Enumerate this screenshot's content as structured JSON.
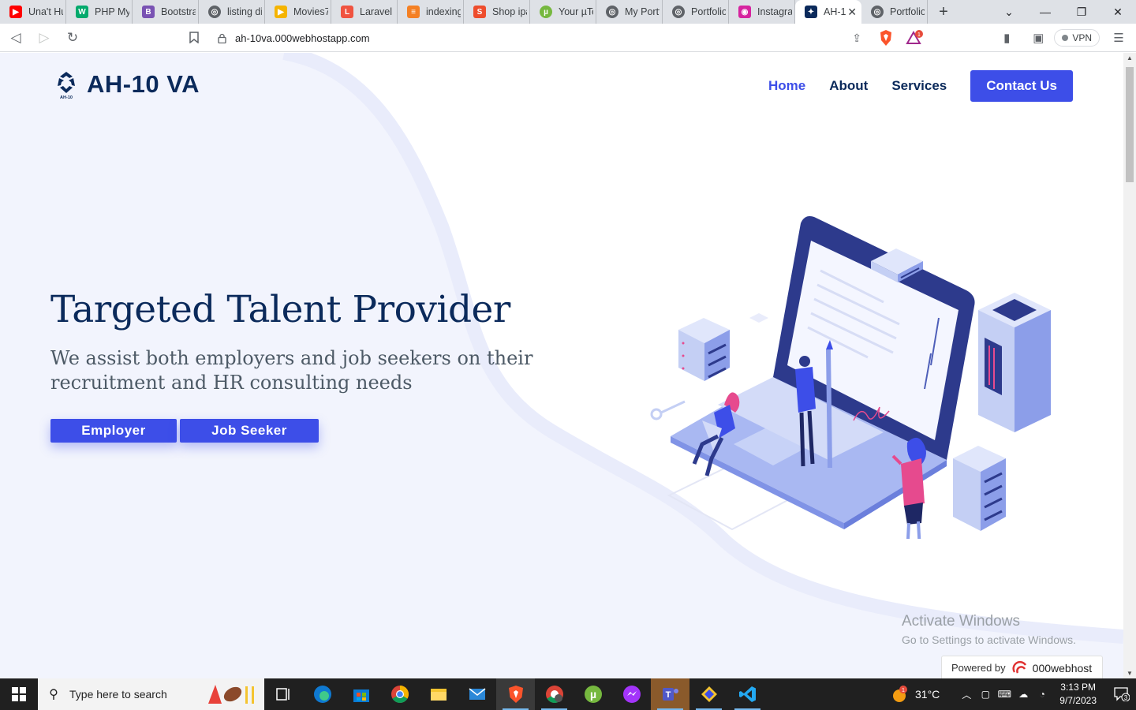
{
  "browser": {
    "tabs": [
      {
        "label": "Una't Hu",
        "icon": "youtube-icon",
        "color": "#ff0000"
      },
      {
        "label": "PHP MyS",
        "icon": "w3schools-icon",
        "color": "#04aa6d"
      },
      {
        "label": "Bootstra",
        "icon": "bootstrap-icon",
        "color": "#7952b3"
      },
      {
        "label": "listing di",
        "icon": "globe-icon",
        "color": "#5f6368"
      },
      {
        "label": "Movies7",
        "icon": "play-icon",
        "color": "#f5b400"
      },
      {
        "label": "Laravel D",
        "icon": "laravel-icon",
        "color": "#f05340"
      },
      {
        "label": "indexing",
        "icon": "stackoverflow-icon",
        "color": "#f48024"
      },
      {
        "label": "Shop ipa",
        "icon": "shopee-icon",
        "color": "#ee4d2d"
      },
      {
        "label": "Your µTo",
        "icon": "utorrent-icon",
        "color": "#76b83f"
      },
      {
        "label": "My Portf",
        "icon": "globe-icon",
        "color": "#5f6368"
      },
      {
        "label": "Portfolio",
        "icon": "globe-icon",
        "color": "#5f6368"
      },
      {
        "label": "Instagra",
        "icon": "instagram-icon",
        "color": "#d6249f"
      },
      {
        "label": "AH-1",
        "icon": "ah10-icon",
        "color": "#0b2a5b",
        "active": true
      },
      {
        "label": "Portfolio",
        "icon": "globe-icon",
        "color": "#5f6368"
      }
    ],
    "new_tab": "+",
    "url": "ah-10va.000webhostapp.com",
    "vpn_label": "VPN",
    "rewards_badge": "1"
  },
  "page": {
    "brand": "AH-10 VA",
    "logo_caption": "AH-10",
    "nav": {
      "home": "Home",
      "about": "About",
      "services": "Services",
      "contact": "Contact Us"
    },
    "hero": {
      "title": "Targeted Talent Provider",
      "subtitle": "We assist both employers and job seekers on their recruitment and HR consulting needs",
      "btn_employer": "Employer",
      "btn_seeker": "Job Seeker"
    },
    "watermark": {
      "line1": "Activate Windows",
      "line2": "Go to Settings to activate Windows."
    },
    "powered": {
      "prefix": "Powered by",
      "brand": "000webhost"
    },
    "colors": {
      "primary": "#3d4ee8",
      "navy": "#0b2a5b",
      "hero_bg": "#f2f4fd"
    }
  },
  "taskbar": {
    "search_placeholder": "Type here to search",
    "weather": "31°C",
    "weather_badge": "1",
    "time": "3:13 PM",
    "date": "9/7/2023",
    "notifications": "3",
    "apps": [
      "task-view",
      "edge",
      "store",
      "chrome",
      "file-explorer",
      "mail",
      "brave",
      "chrome-profile",
      "utorrent",
      "messenger",
      "teams",
      "git-tool",
      "vscode"
    ]
  }
}
